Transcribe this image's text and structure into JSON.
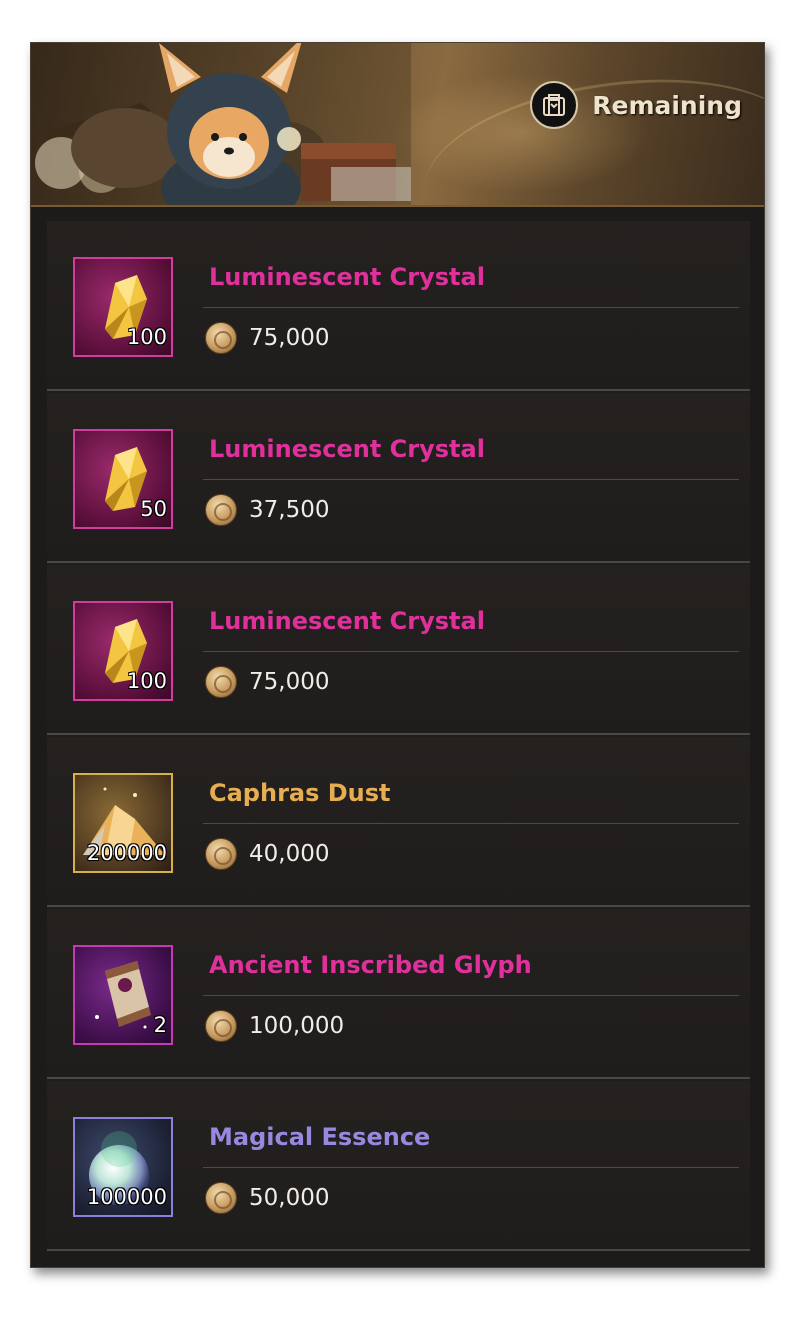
{
  "header": {
    "remaining_label": "Remaining",
    "icon": "bag-icon"
  },
  "items": [
    {
      "name": "Luminescent Crystal",
      "quantity": "100",
      "price": "75,000",
      "grade_color": "#e0309c",
      "icon": "crystal-icon"
    },
    {
      "name": "Luminescent Crystal",
      "quantity": "50",
      "price": "37,500",
      "grade_color": "#e0309c",
      "icon": "crystal-icon"
    },
    {
      "name": "Luminescent Crystal",
      "quantity": "100",
      "price": "75,000",
      "grade_color": "#e0309c",
      "icon": "crystal-icon"
    },
    {
      "name": "Caphras Dust",
      "quantity": "200000",
      "price": "40,000",
      "grade_color": "#e6ad52",
      "icon": "dust-icon"
    },
    {
      "name": "Ancient Inscribed Glyph",
      "quantity": "2",
      "price": "100,000",
      "grade_color": "#e0309c",
      "icon": "scroll-icon"
    },
    {
      "name": "Magical Essence",
      "quantity": "100000",
      "price": "50,000",
      "grade_color": "#9a88e0",
      "icon": "orb-icon"
    }
  ],
  "currency_icon": "silver-coin-icon"
}
